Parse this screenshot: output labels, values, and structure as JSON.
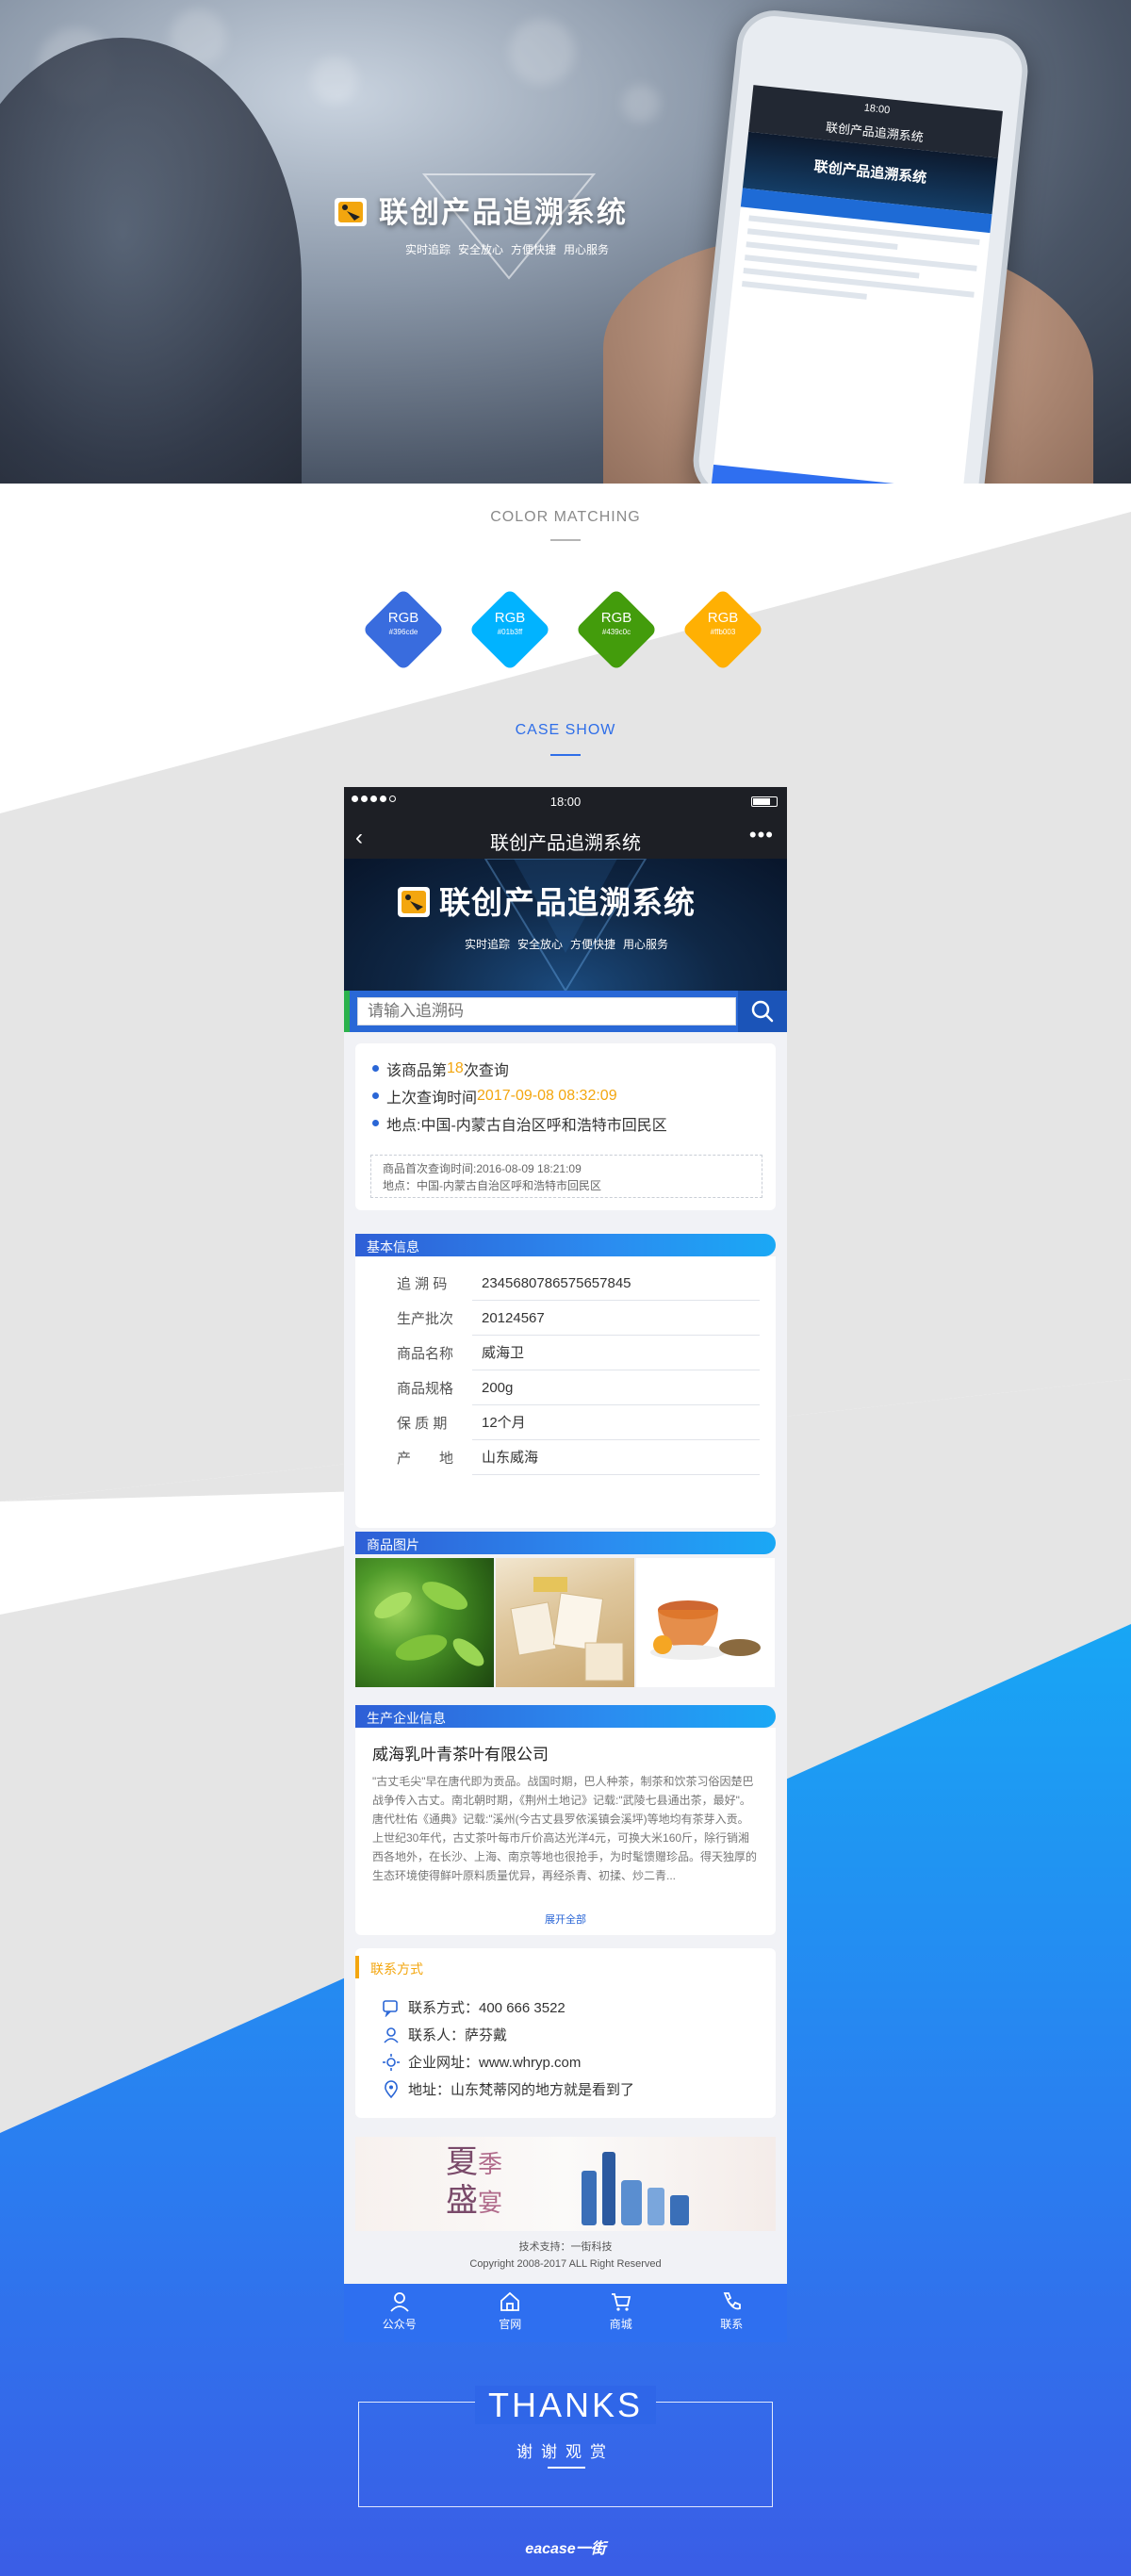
{
  "hero": {
    "title": "联创产品追溯系统",
    "slogans": [
      "实时追踪",
      "安全放心",
      "方便快捷",
      "用心服务"
    ],
    "phone_title": "联创产品追溯系统",
    "phone_time": "18:00"
  },
  "color_section": {
    "title": "COLOR  MATCHING",
    "swatches": [
      {
        "label": "RGB",
        "hex_label": "#396cde",
        "color": "#396cde"
      },
      {
        "label": "RGB",
        "hex_label": "#01b3ff",
        "color": "#01b3ff"
      },
      {
        "label": "RGB",
        "hex_label": "#439c0c",
        "color": "#439c0c"
      },
      {
        "label": "RGB",
        "hex_label": "#ffb003",
        "color": "#ffb003"
      }
    ]
  },
  "case_section": {
    "title": "CASE SHOW"
  },
  "app": {
    "status_time": "18:00",
    "nav_title": "联创产品追溯系统",
    "nav_back": "‹",
    "nav_more": "•••",
    "banner_title": "联创产品追溯系统",
    "banner_slogans": [
      "实时追踪",
      "安全放心",
      "方便快捷",
      "用心服务"
    ],
    "search_placeholder": "请输入追溯码",
    "query": {
      "line1_pre": "该商品第 ",
      "line1_count": "18",
      "line1_post": " 次查询",
      "line2_pre": "上次查询时间 ",
      "line2_time": "2017-09-08 08:32:09",
      "line3": "地点:中国-内蒙古自治区呼和浩特市回民区",
      "first_query": "商品首次查询时间:2016-08-09 18:21:09",
      "first_place": "地点：中国-内蒙古自治区呼和浩特市回民区"
    },
    "basic_info": {
      "heading": "基本信息",
      "rows": [
        {
          "k": "追 溯 码",
          "v": "2345680786575657845"
        },
        {
          "k": "生产批次",
          "v": "20124567"
        },
        {
          "k": "商品名称",
          "v": "威海卫"
        },
        {
          "k": "商品规格",
          "v": "200g"
        },
        {
          "k": "保 质 期",
          "v": "12个月"
        },
        {
          "k": "产　　地",
          "v": "山东威海"
        }
      ]
    },
    "pictures_heading": "商品图片",
    "company": {
      "heading": "生产企业信息",
      "name": "威海乳叶青茶叶有限公司",
      "desc": "\"古丈毛尖\"早在唐代即为贡品。战国时期，巴人种茶，制茶和饮茶习俗因楚巴战争传入古丈。南北朝时期，《荆州土地记》记载:\"武陵七县通出茶，最好\"。唐代杜佑《通典》记载:\"溪州(今古丈县罗依溪镇会溪坪)等地均有茶芽入贡。上世纪30年代，古丈茶叶每市斤价高达光洋4元，可换大米160斤，除行销湘西各地外，在长沙、上海、南京等地也很抢手，为时髦馈赠珍品。得天独厚的生态环境使得鲜叶原料质量优异，再经杀青、初揉、炒二青...",
      "more": "展开全部"
    },
    "contact": {
      "heading": "联系方式",
      "rows": [
        {
          "icon": "chat-icon",
          "text": "联系方式：400 666 3522"
        },
        {
          "icon": "person-icon",
          "text": "联系人：萨芬戴"
        },
        {
          "icon": "sun-icon",
          "text": "企业网址：www.whryp.com"
        },
        {
          "icon": "location-icon",
          "text": "地址：山东梵蒂冈的地方就是看到了"
        }
      ]
    },
    "ad": {
      "line1": "夏",
      "line2": "季",
      "line3": "盛",
      "line4": "宴"
    },
    "footer": {
      "support": "技术支持：一街科技",
      "copyright": "Copyright 2008-2017 ALL Right Reserved"
    },
    "tabs": [
      {
        "icon": "person-icon",
        "label": "公众号"
      },
      {
        "icon": "home-icon",
        "label": "官网"
      },
      {
        "icon": "cart-icon",
        "label": "商城"
      },
      {
        "icon": "phone-icon",
        "label": "联系"
      }
    ]
  },
  "thanks": {
    "title": "THANKS",
    "subtitle": "谢谢观赏",
    "brand": "eacase一街"
  }
}
